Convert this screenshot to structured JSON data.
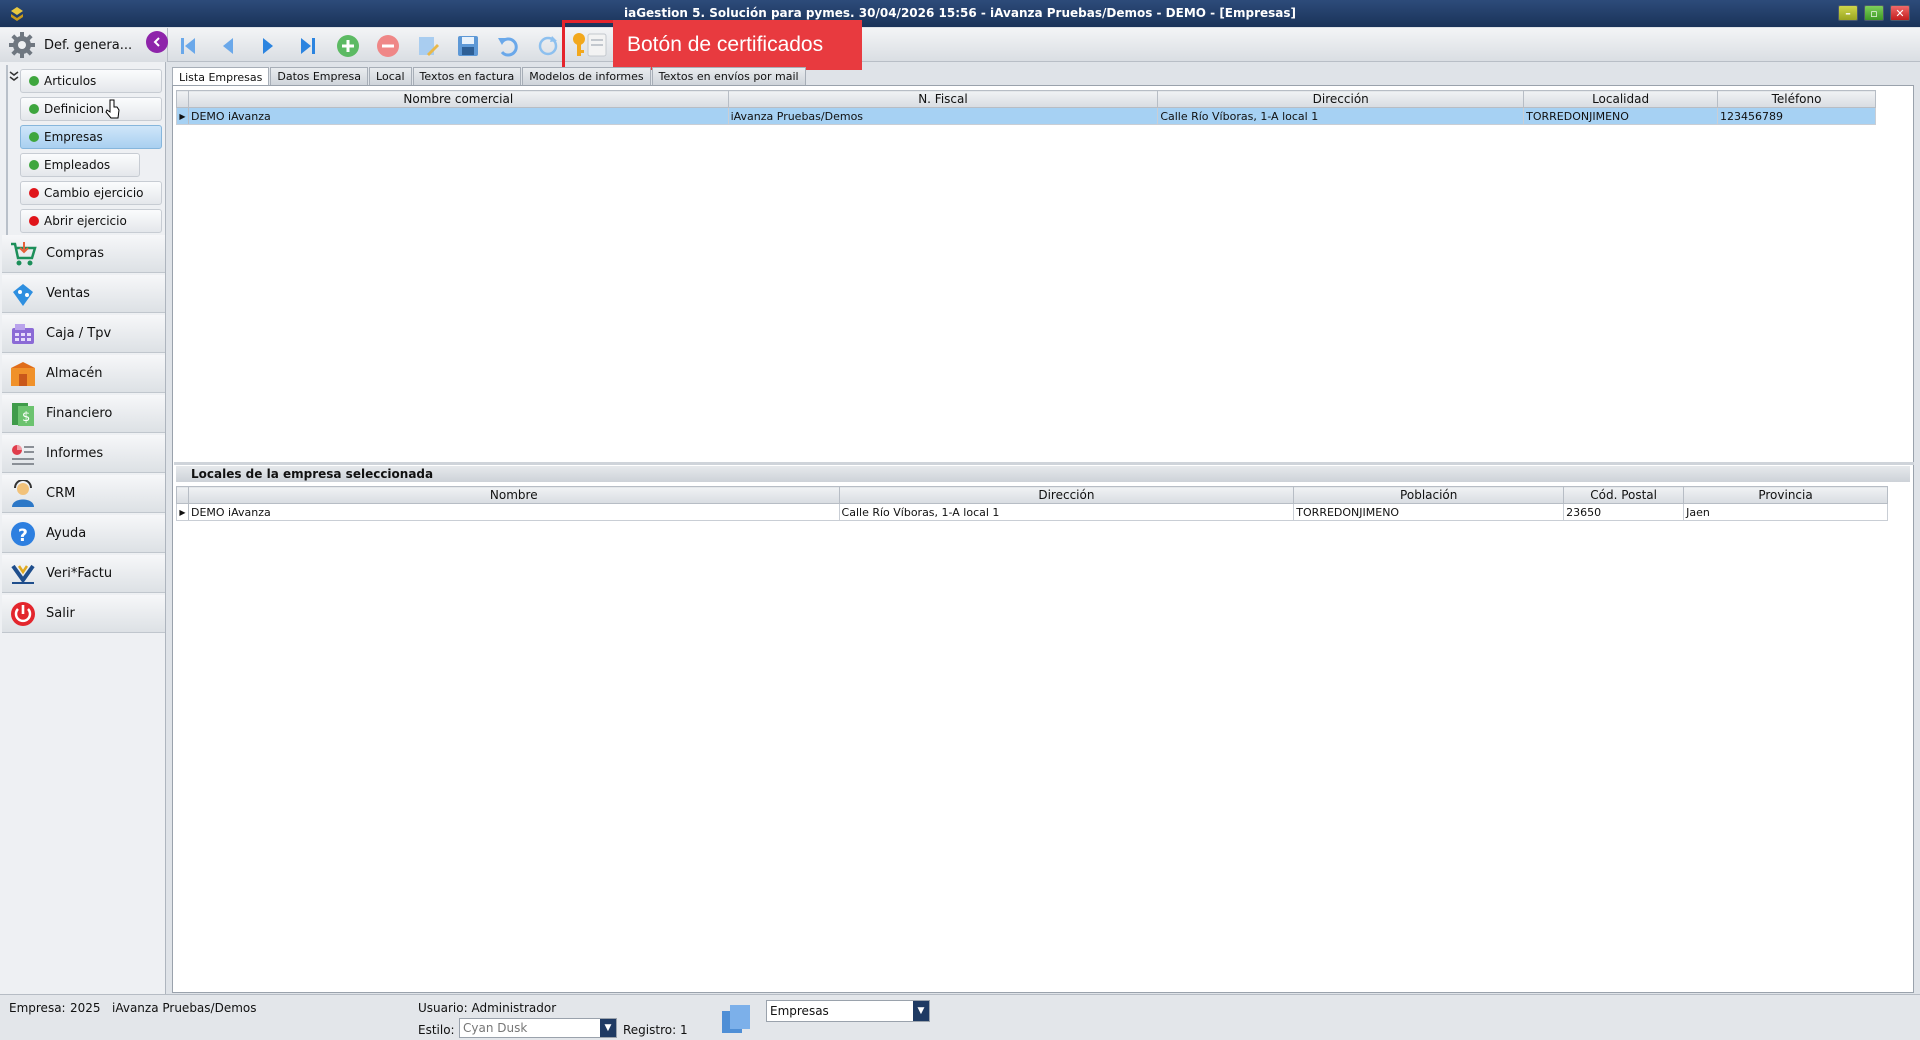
{
  "window": {
    "title": "iaGestion 5. Solución para pymes.  30/04/2026 15:56  -  iAvanza Pruebas/Demos - DEMO - [Empresas]"
  },
  "module_head": {
    "label": "Def. genera..."
  },
  "callout": {
    "label": "Botón de certificados"
  },
  "submenu": [
    {
      "label": "Articulos",
      "status": "green"
    },
    {
      "label": "Definicion",
      "status": "green"
    },
    {
      "label": "Empresas",
      "status": "green"
    },
    {
      "label": "Empleados",
      "status": "green"
    },
    {
      "label": "Cambio ejercicio",
      "status": "red"
    },
    {
      "label": "Abrir ejercicio",
      "status": "red"
    }
  ],
  "modules": [
    {
      "label": "Compras",
      "icon": "cart-icon"
    },
    {
      "label": "Ventas",
      "icon": "sales-icon"
    },
    {
      "label": "Caja / Tpv",
      "icon": "cash-register-icon"
    },
    {
      "label": "Almacén",
      "icon": "warehouse-icon"
    },
    {
      "label": "Financiero",
      "icon": "finance-icon"
    },
    {
      "label": "Informes",
      "icon": "reports-icon"
    },
    {
      "label": "CRM",
      "icon": "crm-icon"
    },
    {
      "label": "Ayuda",
      "icon": "help-icon"
    },
    {
      "label": "Veri*Factu",
      "icon": "verifactu-icon"
    },
    {
      "label": "Salir",
      "icon": "power-icon"
    }
  ],
  "tabs": [
    "Lista Empresas",
    "Datos Empresa",
    "Local",
    "Textos en factura",
    "Modelos de informes",
    "Textos en envíos por mail"
  ],
  "companies": {
    "columns": [
      "Nombre comercial",
      "N. Fiscal",
      "Dirección",
      "Localidad",
      "Teléfono"
    ],
    "rows": [
      [
        "DEMO iAvanza",
        "iAvanza Pruebas/Demos",
        "Calle Río Víboras, 1-A local 1",
        "TORREDONJIMENO",
        "123456789"
      ]
    ]
  },
  "locales": {
    "title": "Locales de la empresa seleccionada",
    "columns": [
      "Nombre",
      "Dirección",
      "Población",
      "Cód. Postal",
      "Provincia"
    ],
    "rows": [
      [
        "DEMO iAvanza",
        "Calle Río Víboras, 1-A local 1",
        "TORREDONJIMENO",
        "23650",
        "Jaen"
      ]
    ]
  },
  "status": {
    "empresa_label": "Empresa:",
    "empresa_year": "2025",
    "empresa_name": "iAvanza Pruebas/Demos",
    "usuario": "Usuario: Administrador",
    "estilo_label": "Estilo:",
    "estilo_value": "Cyan Dusk",
    "registro": "Registro:  1",
    "view_value": "Empresas"
  }
}
